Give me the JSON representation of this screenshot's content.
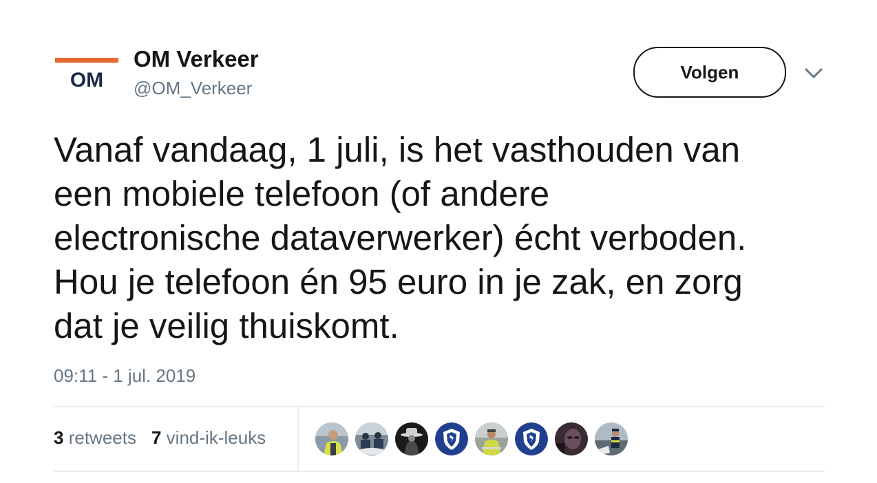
{
  "account": {
    "logo_text": "OM",
    "display_name": "OM Verkeer",
    "handle": "@OM_Verkeer"
  },
  "follow_label": "Volgen",
  "tweet": {
    "lines": [
      "Vanaf vandaag, 1 juli, is het vasthouden van",
      "een mobiele telefoon (of andere",
      "electronische dataverwerker) écht verboden.",
      "Hou je telefoon én 95 euro in je zak, en zorg",
      "dat je veilig thuiskomt."
    ],
    "timestamp": "09:11 - 1 jul. 2019"
  },
  "stats": {
    "retweets_count": "3",
    "retweets_label": "retweets",
    "likes_count": "7",
    "likes_label": "vind-ik-leuks"
  },
  "likers": [
    {
      "icon": "person-yellow-vest-photo"
    },
    {
      "icon": "motorcycle-officers-photo"
    },
    {
      "icon": "hat-silhouette-photo"
    },
    {
      "icon": "police-badge-logo"
    },
    {
      "icon": "person-yellow-vest-photo"
    },
    {
      "icon": "police-badge-logo"
    },
    {
      "icon": "dark-portrait-photo"
    },
    {
      "icon": "officer-outdoor-photo"
    }
  ],
  "colors": {
    "text": "#14171a",
    "secondary_text": "#657786",
    "divider": "#e6ecf0",
    "logo_orange": "#e8692c",
    "logo_navy": "#1b2a4a",
    "police_blue": "#1f3f8f"
  }
}
